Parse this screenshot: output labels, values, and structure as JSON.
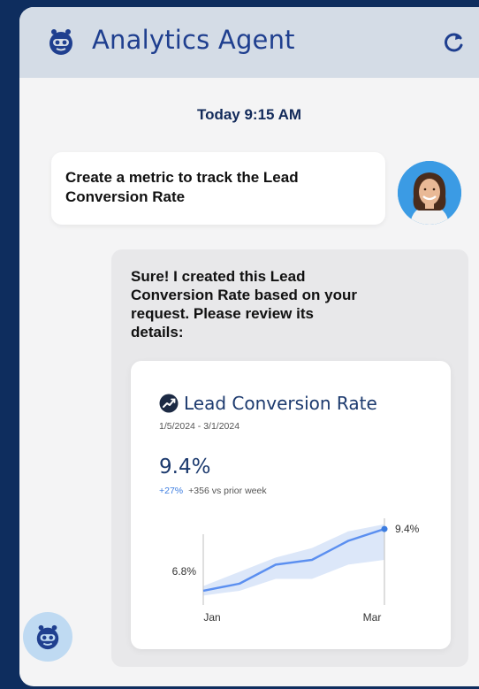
{
  "header": {
    "title": "Analytics Agent",
    "icon": "robot-icon",
    "refresh_icon": "refresh-icon"
  },
  "conversation": {
    "timestamp": "Today 9:15 AM",
    "user_message": "Create a metric to track the Lead Conversion Rate",
    "agent_message": "Sure! I created this Lead Conversion Rate based on your request. Please review its details:"
  },
  "metric_card": {
    "icon": "trend-icon",
    "title": "Lead Conversion Rate",
    "date_range": "1/5/2024 - 3/1/2024",
    "value": "9.4%",
    "delta_percent": "+27%",
    "delta_text": "+356 vs prior week"
  },
  "colors": {
    "brand": "#1f3f8f",
    "background": "#0e2d5e",
    "header": "#d4dce6",
    "accent": "#3d7de0",
    "band": "#dce7f9"
  },
  "chart_data": {
    "type": "line",
    "x": [
      "Jan",
      "",
      "",
      "",
      "",
      "Mar"
    ],
    "values": [
      6.8,
      7.1,
      7.9,
      8.1,
      8.9,
      9.4
    ],
    "band_low": [
      6.6,
      6.8,
      7.3,
      7.3,
      7.9,
      8.1
    ],
    "band_high": [
      7.0,
      7.6,
      8.2,
      8.6,
      9.3,
      9.6
    ],
    "ylim": [
      6.5,
      9.7
    ],
    "x_tick_labels": [
      "Jan",
      "Mar"
    ],
    "start_label": "6.8%",
    "end_label": "9.4%",
    "grid": false
  }
}
